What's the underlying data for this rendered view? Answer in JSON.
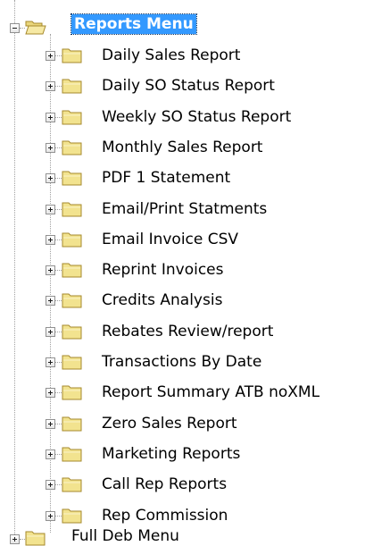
{
  "tree": {
    "root": {
      "label": "Reports Menu",
      "icon": "folder-open-icon",
      "expanded": true,
      "selected": true,
      "children": [
        {
          "label": "Daily Sales Report",
          "icon": "folder-icon",
          "expanded": false
        },
        {
          "label": "Daily SO Status Report",
          "icon": "folder-icon",
          "expanded": false
        },
        {
          "label": "Weekly SO Status Report",
          "icon": "folder-icon",
          "expanded": false
        },
        {
          "label": "Monthly Sales Report",
          "icon": "folder-icon",
          "expanded": false
        },
        {
          "label": "PDF 1 Statement",
          "icon": "folder-icon",
          "expanded": false
        },
        {
          "label": "Email/Print Statments",
          "icon": "folder-icon",
          "expanded": false
        },
        {
          "label": "Email Invoice CSV",
          "icon": "folder-icon",
          "expanded": false
        },
        {
          "label": "Reprint Invoices",
          "icon": "folder-icon",
          "expanded": false
        },
        {
          "label": "Credits Analysis",
          "icon": "folder-icon",
          "expanded": false
        },
        {
          "label": "Rebates Review/report",
          "icon": "folder-icon",
          "expanded": false
        },
        {
          "label": "Transactions By Date",
          "icon": "folder-icon",
          "expanded": false
        },
        {
          "label": "Report Summary ATB noXML",
          "icon": "folder-icon",
          "expanded": false
        },
        {
          "label": "Zero Sales Report",
          "icon": "folder-icon",
          "expanded": false
        },
        {
          "label": "Marketing Reports",
          "icon": "folder-icon",
          "expanded": false
        },
        {
          "label": "Call Rep Reports",
          "icon": "folder-icon",
          "expanded": false
        },
        {
          "label": "Rep Commission",
          "icon": "folder-icon",
          "expanded": false
        }
      ]
    },
    "next_sibling": {
      "label": "Full Deb Menu",
      "icon": "folder-icon",
      "expanded": false
    },
    "colors": {
      "selection_bg": "#3399ff",
      "selection_text": "#ffffff",
      "folder_fill": "#f2e38f",
      "folder_outline": "#a6892c",
      "connector": "#a0a0a0"
    }
  }
}
